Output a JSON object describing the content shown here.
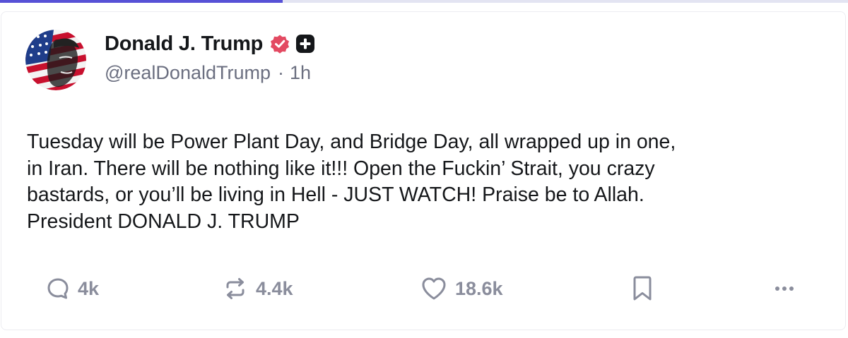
{
  "progress": {
    "fraction": 0.333,
    "fill_color": "#5751d6",
    "track_color": "#e3e4f2"
  },
  "post": {
    "author": {
      "display_name": "Donald J. Trump",
      "handle": "@realDonaldTrump",
      "separator": "·",
      "time_ago": "1h",
      "avatar_icon": "flag-portrait-avatar",
      "verified_icon": "verified-badge-icon",
      "verified_color": "#e34a62",
      "plus_icon": "plus-badge-icon"
    },
    "text": "Tuesday will be Power Plant Day, and Bridge Day, all wrapped up in one,\nin Iran. There will be nothing like it!!! Open the Fuckin’ Strait, you crazy\nbastards, or you’ll be living in Hell - JUST WATCH! Praise be to Allah.\nPresident DONALD J. TRUMP"
  },
  "actions": {
    "reply": {
      "icon": "reply-icon",
      "count": "4k"
    },
    "retruth": {
      "icon": "retruth-icon",
      "count": "4.4k"
    },
    "like": {
      "icon": "heart-icon",
      "count": "18.6k"
    },
    "bookmark": {
      "icon": "bookmark-icon"
    },
    "more": {
      "icon": "more-dots-icon"
    }
  }
}
